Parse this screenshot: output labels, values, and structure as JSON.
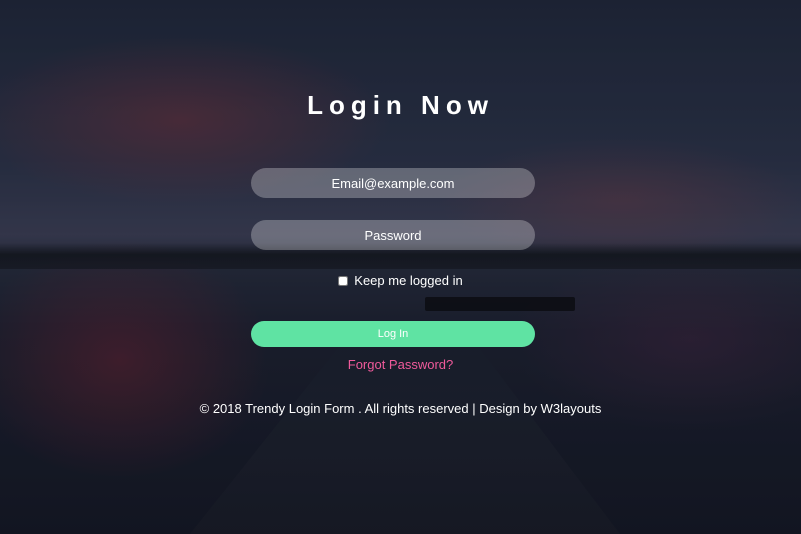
{
  "title": "Login Now",
  "form": {
    "email_placeholder": "Email@example.com",
    "password_placeholder": "Password",
    "remember_label": "Keep me logged in",
    "remember_checked": false,
    "login_label": "Log In",
    "forgot_label": "Forgot Password?"
  },
  "footer": {
    "text": "© 2018 Trendy Login Form . All rights reserved | Design by W3layouts"
  },
  "colors": {
    "accent": "#5fe3a3",
    "link": "#ef5a9b"
  }
}
